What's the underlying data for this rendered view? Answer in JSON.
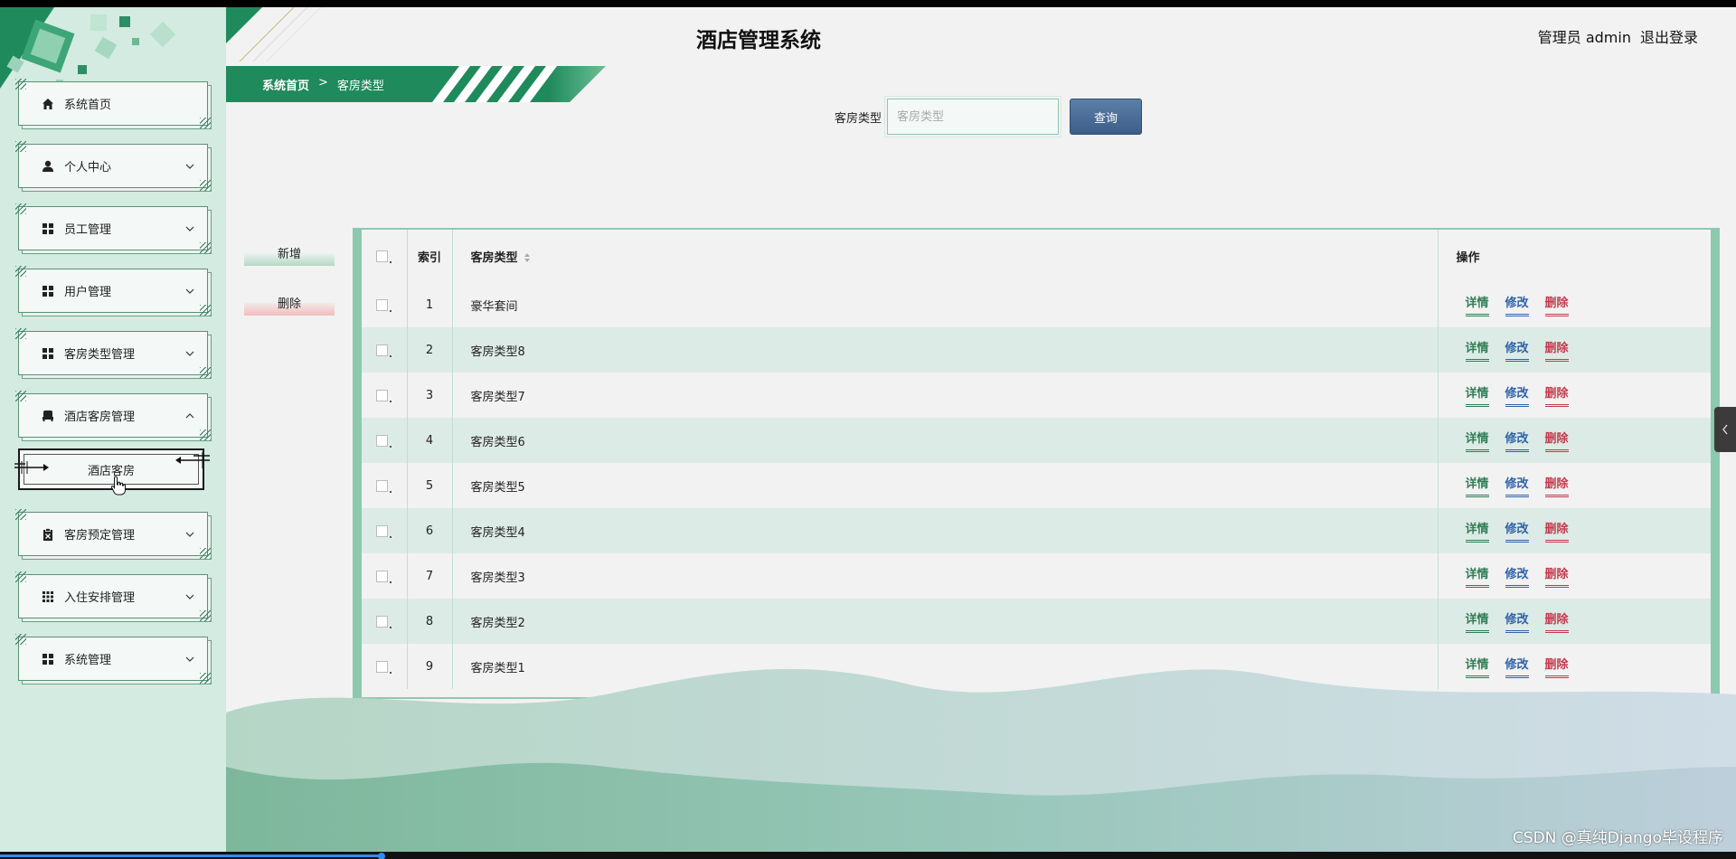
{
  "app": {
    "title": "酒店管理系统"
  },
  "user": {
    "label": "管理员 admin",
    "logout": "退出登录"
  },
  "breadcrumb": {
    "home": "系统首页",
    "separator": ">",
    "current": "客房类型"
  },
  "search": {
    "label": "客房类型",
    "placeholder": "客房类型",
    "value": "",
    "button": "查询"
  },
  "actions": {
    "add": "新增",
    "delete": "删除"
  },
  "sidebar": {
    "items": [
      {
        "label": "系统首页",
        "icon": "home-icon",
        "expandable": false
      },
      {
        "label": "个人中心",
        "icon": "user-icon",
        "expandable": true
      },
      {
        "label": "员工管理",
        "icon": "grid-icon",
        "expandable": true
      },
      {
        "label": "用户管理",
        "icon": "grid-icon",
        "expandable": true
      },
      {
        "label": "客房类型管理",
        "icon": "grid-icon",
        "expandable": true
      },
      {
        "label": "酒店客房管理",
        "icon": "bed-icon",
        "expandable": true,
        "expanded": true,
        "children": [
          "酒店客房"
        ]
      },
      {
        "label": "客房预定管理",
        "icon": "clipboard-icon",
        "expandable": true
      },
      {
        "label": "入住安排管理",
        "icon": "apps-icon",
        "expandable": true
      },
      {
        "label": "系统管理",
        "icon": "grid-icon",
        "expandable": true
      }
    ]
  },
  "table": {
    "headers": {
      "index": "索引",
      "type": "客房类型",
      "operation": "操作"
    },
    "rows": [
      {
        "index": "1",
        "type": "豪华套间"
      },
      {
        "index": "2",
        "type": "客房类型8"
      },
      {
        "index": "3",
        "type": "客房类型7"
      },
      {
        "index": "4",
        "type": "客房类型6"
      },
      {
        "index": "5",
        "type": "客房类型5"
      },
      {
        "index": "6",
        "type": "客房类型4"
      },
      {
        "index": "7",
        "type": "客房类型3"
      },
      {
        "index": "8",
        "type": "客房类型2"
      },
      {
        "index": "9",
        "type": "客房类型1"
      }
    ],
    "row_actions": {
      "detail": "详情",
      "edit": "修改",
      "delete": "删除"
    }
  },
  "watermark": "CSDN @真纯Django毕设程序",
  "video_progress": 0.22,
  "colors": {
    "brand_green": "#1f8a5b",
    "sidebar_bg": "#d3ebe0",
    "query_button": "#3c5e89",
    "detail": "#2f7d55",
    "edit": "#2f63a8",
    "delete": "#c23a4d"
  }
}
